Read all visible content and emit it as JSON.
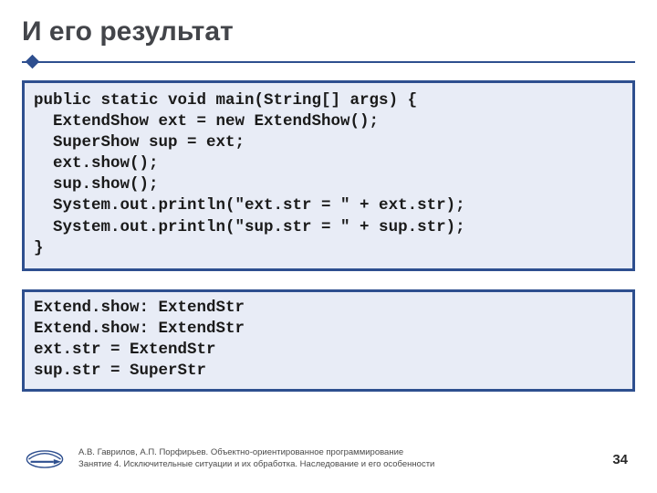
{
  "title": "И его результат",
  "code": "public static void main(String[] args) {\n  ExtendShow ext = new ExtendShow();\n  SuperShow sup = ext;\n  ext.show();\n  sup.show();\n  System.out.println(\"ext.str = \" + ext.str);\n  System.out.println(\"sup.str = \" + sup.str);\n}",
  "output": "Extend.show: ExtendStr\nExtend.show: ExtendStr\next.str = ExtendStr\nsup.str = SuperStr",
  "footer": {
    "line1": "А.В. Гаврилов, А.П. Порфирьев. Объектно-ориентированное программирование",
    "line2": "Занятие 4. Исключительные ситуации и их обработка. Наследование и его особенности"
  },
  "page": "34"
}
